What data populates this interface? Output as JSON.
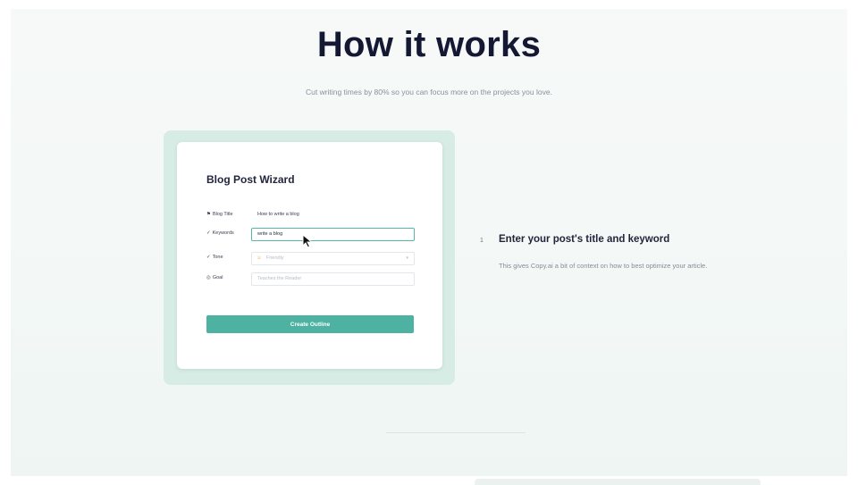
{
  "header": {
    "title": "How it works",
    "subtitle": "Cut writing times by 80% so you can focus more on the projects you love."
  },
  "wizard": {
    "title": "Blog Post Wizard",
    "fields": {
      "blog_title": {
        "icon": "flag-icon",
        "label": "Blog Title",
        "value": "How to write a blog"
      },
      "keywords": {
        "icon": "check-icon",
        "label": "Keywords",
        "value": "write a blog"
      },
      "tone": {
        "icon": "check-icon",
        "label": "Tone",
        "value": "Friendly",
        "emoji": "smiley-icon"
      },
      "goal": {
        "icon": "target-icon",
        "label": "Goal",
        "placeholder": "Teaches the Reader"
      }
    },
    "button_label": "Create Outline"
  },
  "step": {
    "number": "1",
    "title": "Enter your post's title and keyword",
    "description": "This gives Copy.ai a bit of context on how to best optimize your article."
  },
  "colors": {
    "accent": "#4db2a1",
    "card_glow": "#d6ece5",
    "heading": "#141833"
  }
}
